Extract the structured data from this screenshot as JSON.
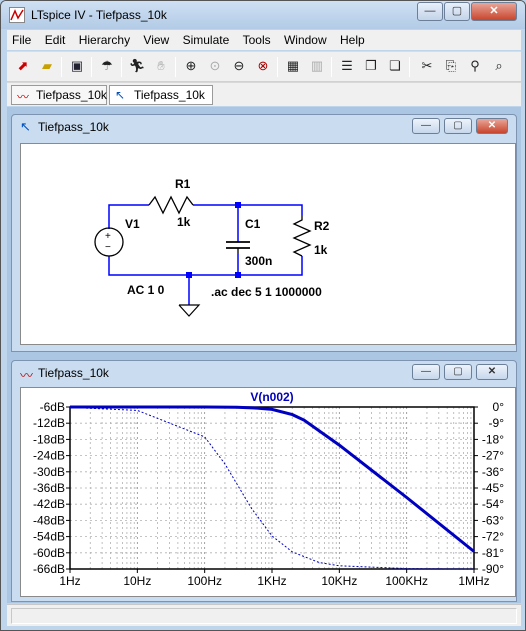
{
  "window": {
    "title": "LTspice IV - Tiefpass_10k",
    "minimize": "—",
    "maximize": "▢",
    "close": "✕"
  },
  "menu": {
    "items": [
      {
        "label": "File"
      },
      {
        "label": "Edit"
      },
      {
        "label": "Hierarchy"
      },
      {
        "label": "View"
      },
      {
        "label": "Simulate"
      },
      {
        "label": "Tools"
      },
      {
        "label": "Window"
      },
      {
        "label": "Help"
      }
    ]
  },
  "toolbar": {
    "icons": [
      "schematic-icon",
      "open-icon",
      "save-icon",
      "control-panel-icon",
      "run-icon",
      "halt-icon",
      "zoom-in-icon",
      "zoom-full-icon",
      "zoom-out-icon",
      "autorange-icon",
      "waveform-icon",
      "fft-icon",
      "tile-horizontal-icon",
      "cascade-icon",
      "tile-vertical-icon",
      "cut-icon",
      "copy-icon",
      "find-icon"
    ]
  },
  "tabs": [
    {
      "label": "Tiefpass_10k"
    },
    {
      "label": "Tiefpass_10k"
    }
  ],
  "schematic_window": {
    "title": "Tiefpass_10k",
    "components": {
      "r1_name": "R1",
      "r1_value": "1k",
      "c1_name": "C1",
      "c1_value": "300n",
      "r2_name": "R2",
      "r2_value": "1k",
      "v1_name": "V1",
      "v1_value": "AC 1 0",
      "directive": ".ac dec 5 1 1000000"
    }
  },
  "plot_window": {
    "title": "Tiefpass_10k",
    "trace_name": "V(n002)"
  },
  "chart_data": {
    "type": "line",
    "title": "",
    "trace": "V(n002)",
    "x_scale": "log",
    "xlim": [
      1,
      1000000
    ],
    "x_ticks": [
      "1Hz",
      "10Hz",
      "100Hz",
      "1KHz",
      "10KHz",
      "100KHz",
      "1MHz"
    ],
    "y_left_ticks": [
      "-6dB",
      "-12dB",
      "-18dB",
      "-24dB",
      "-30dB",
      "-36dB",
      "-42dB",
      "-48dB",
      "-54dB",
      "-60dB",
      "-66dB"
    ],
    "y_left_lim": [
      -66,
      -6
    ],
    "y_right_ticks": [
      "0°",
      "-9°",
      "-18°",
      "-27°",
      "-36°",
      "-45°",
      "-54°",
      "-63°",
      "-72°",
      "-81°",
      "-90°"
    ],
    "y_right_lim": [
      -90,
      0
    ],
    "grid": true,
    "color": "#0000c0",
    "series": [
      {
        "style": "solid",
        "x": [
          1,
          10,
          100,
          300,
          600,
          1000,
          2000,
          3000,
          10000,
          100000,
          1000000
        ],
        "y": [
          -6.0,
          -6.0,
          -6.0,
          -6.1,
          -6.4,
          -6.9,
          -8.8,
          -10.9,
          -20.1,
          -39.5,
          -59.5
        ]
      },
      {
        "style": "dashed",
        "x": [
          1,
          10,
          100,
          200,
          500,
          1000,
          2000,
          5000,
          10000,
          100000,
          1000000
        ],
        "y": [
          -0.2,
          -1.9,
          -16.6,
          -31.6,
          -56.5,
          -71.6,
          -80.5,
          -86.4,
          -88.2,
          -89.8,
          -90.0
        ]
      }
    ]
  }
}
